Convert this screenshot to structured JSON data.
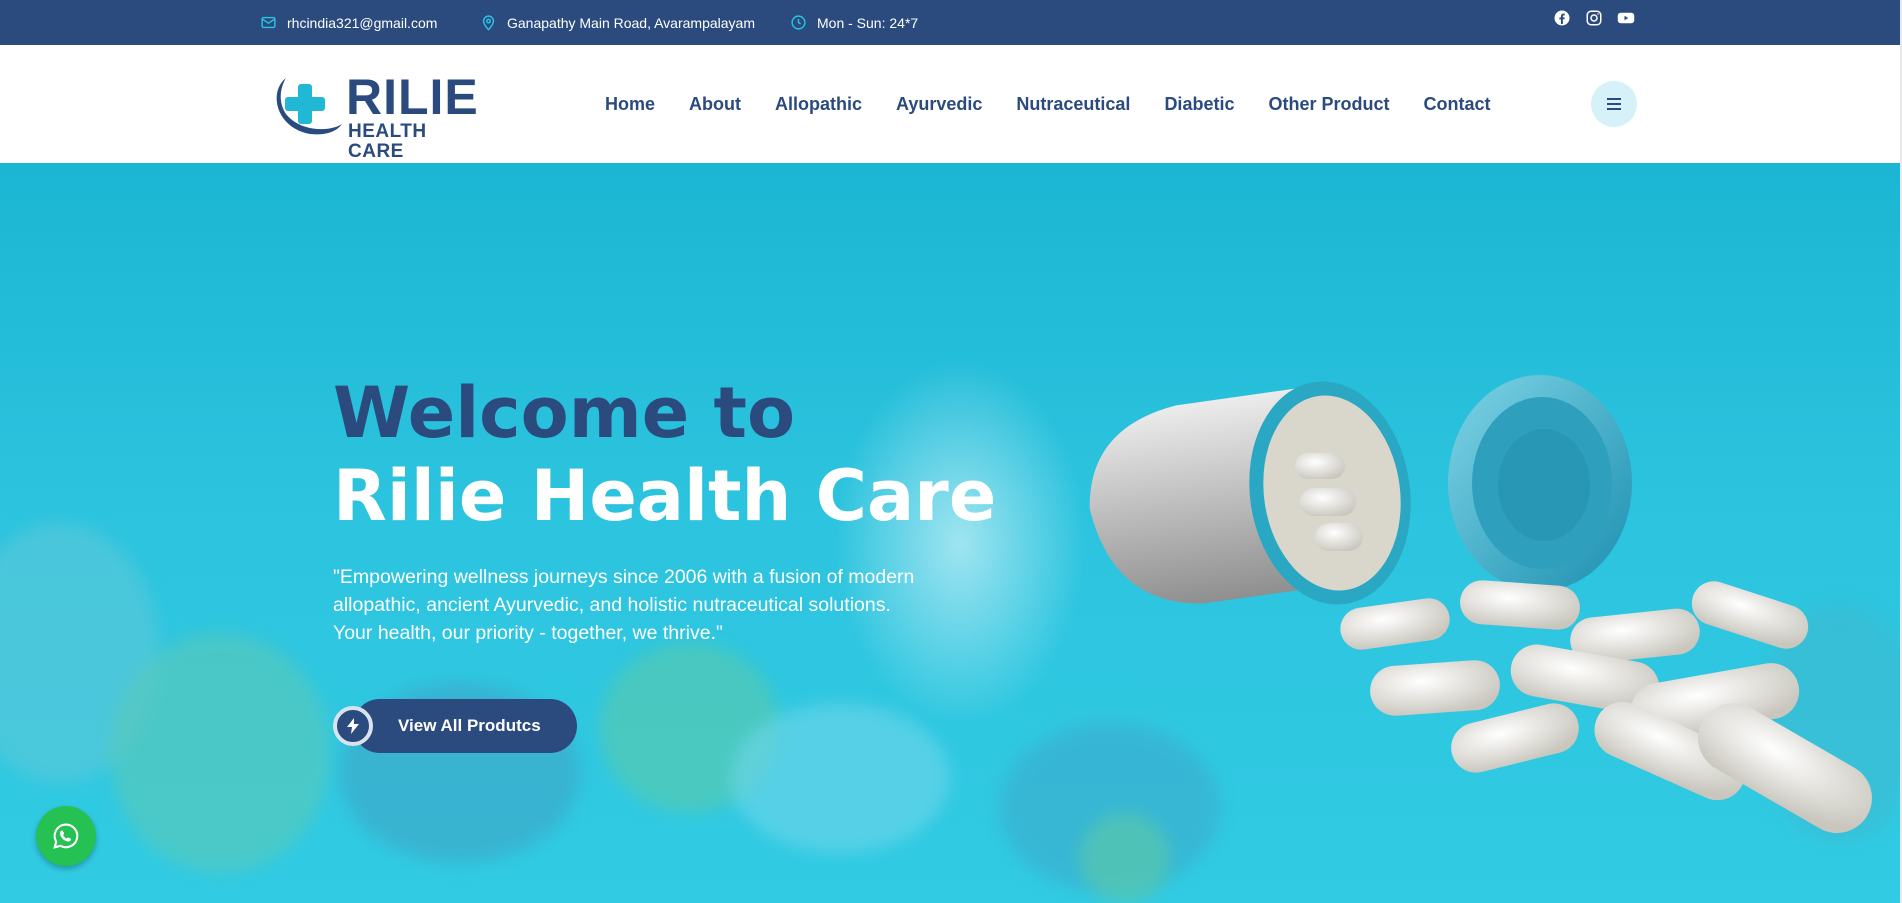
{
  "topbar": {
    "email": "rhcindia321@gmail.com",
    "address": "Ganapathy Main Road, Avarampalayam",
    "hours": "Mon - Sun: 24*7",
    "icons": [
      "mail-icon",
      "location-pin-icon",
      "clock-icon"
    ],
    "social": [
      "facebook-icon",
      "instagram-icon",
      "youtube-icon"
    ]
  },
  "logo": {
    "line1": "RILIE",
    "line2": "HEALTH CARE"
  },
  "nav": {
    "items": [
      "Home",
      "About",
      "Allopathic",
      "Ayurvedic",
      "Nutraceutical",
      "Diabetic",
      "Other Product",
      "Contact"
    ]
  },
  "hero": {
    "title_line1": "Welcome to",
    "title_line2": "Rilie Health Care",
    "description": "\"Empowering wellness journeys since 2006 with a fusion of modern allopathic, ancient Ayurvedic, and holistic nutraceutical solutions. Your health, our priority - together, we thrive.\"",
    "button_label": "View All Produtcs"
  },
  "colors": {
    "brand_navy": "#2b4a7d",
    "accent_cyan": "#21b8d6",
    "whatsapp_green": "#25c152"
  }
}
